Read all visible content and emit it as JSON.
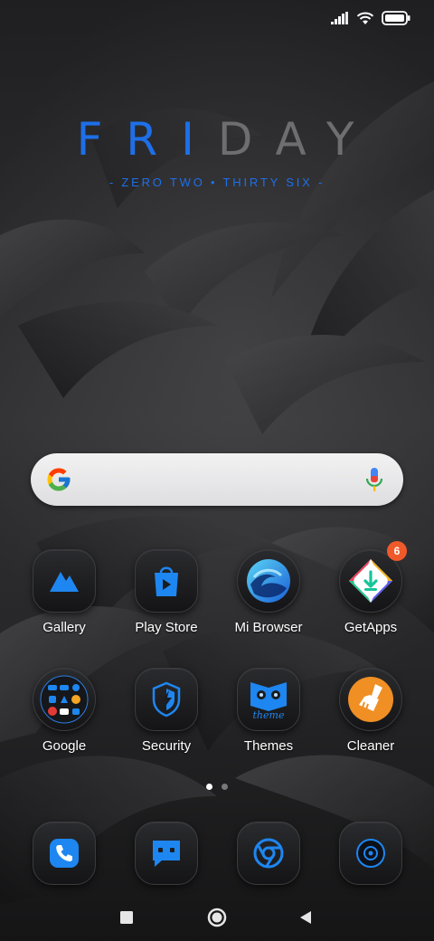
{
  "status_bar": {
    "icons": [
      "signal-icon",
      "wifi-icon",
      "battery-icon"
    ]
  },
  "widget": {
    "day_highlight": "FRI",
    "day_rest": "DAY",
    "time_words": "- ZERO TWO • THIRTY SIX -",
    "accent_color": "#1e6fe8"
  },
  "search": {
    "icons": [
      "google-logo-icon",
      "microphone-icon"
    ]
  },
  "apps": [
    {
      "label": "Gallery",
      "icon": "gallery-icon"
    },
    {
      "label": "Play Store",
      "icon": "play-store-icon"
    },
    {
      "label": "Mi Browser",
      "icon": "mi-browser-icon"
    },
    {
      "label": "GetApps",
      "icon": "getapps-icon",
      "badge": "6"
    },
    {
      "label": "Google",
      "icon": "google-folder-icon"
    },
    {
      "label": "Security",
      "icon": "security-shield-icon"
    },
    {
      "label": "Themes",
      "icon": "themes-icon",
      "icon_text": "theme"
    },
    {
      "label": "Cleaner",
      "icon": "cleaner-brush-icon"
    }
  ],
  "page_indicator": {
    "count": 2,
    "active": 0
  },
  "dock": [
    {
      "icon": "phone-icon"
    },
    {
      "icon": "messages-icon"
    },
    {
      "icon": "chrome-icon"
    },
    {
      "icon": "camera-icon"
    }
  ],
  "nav_bar": {
    "buttons": [
      "recents-square-icon",
      "home-circle-icon",
      "back-triangle-icon"
    ]
  }
}
